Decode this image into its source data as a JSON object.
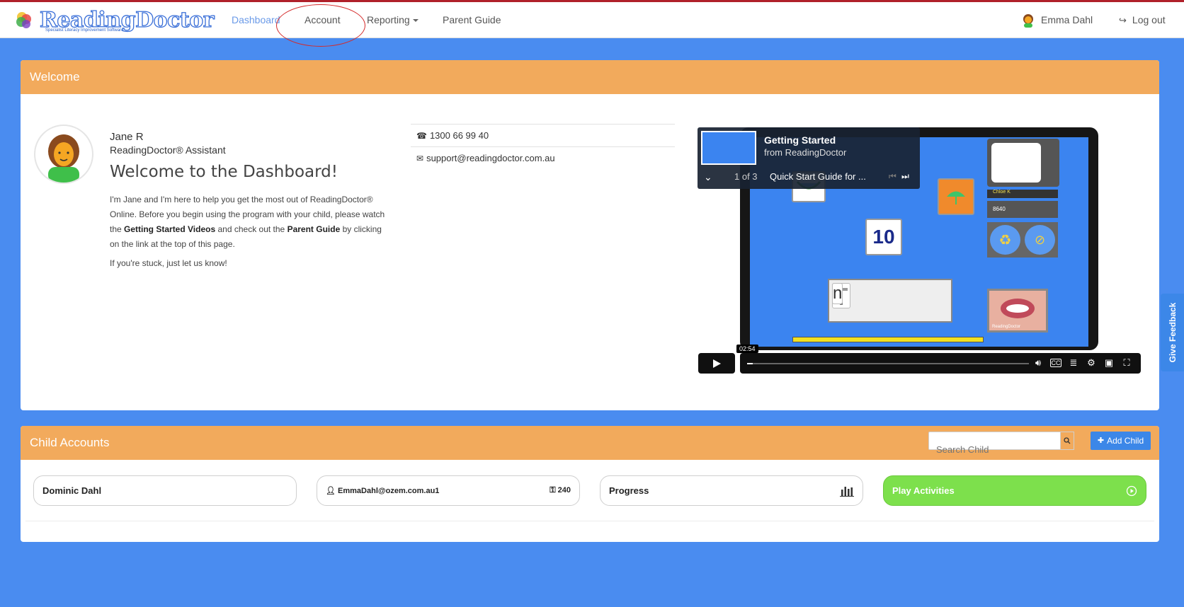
{
  "nav": {
    "logo_text": "ReadingDoctor",
    "logo_tagline": "Specialist Literacy Improvement Software",
    "items": [
      {
        "label": "Dashboard"
      },
      {
        "label": "Account"
      },
      {
        "label": "Reporting"
      },
      {
        "label": "Parent Guide"
      }
    ],
    "user_name": "Emma Dahl",
    "logout_label": "Log out"
  },
  "welcome": {
    "heading": "Welcome",
    "assistant_name": "Jane R",
    "assistant_role": "ReadingDoctor® Assistant",
    "title": "Welcome to the Dashboard!",
    "para_1": "I'm Jane and I'm here to help you get the most out of ReadingDoctor® Online. Before you begin using the program with your child, please watch the ",
    "para_bold_1": "Getting Started Videos",
    "para_2": " and check out the ",
    "para_bold_2": "Parent Guide",
    "para_3": " by clicking on the link at the top of this page.",
    "stuck_text": "If you're stuck, just let us know!",
    "phone": "1300 66 99 40",
    "email": "support@readingdoctor.com.au"
  },
  "video": {
    "title": "Getting Started",
    "from": "from ReadingDoctor",
    "playlist_count": "1 of 3",
    "next_title": "Quick Start Guide for ...",
    "time": "02:54",
    "progress": 0.02,
    "screen_labels": {
      "number": "10",
      "letter_1": "i",
      "letter_2": "n",
      "name_tag": "Chloe K",
      "score": "8640",
      "mouth_label": "ReadingDoctor"
    }
  },
  "children": {
    "heading": "Child Accounts",
    "search_placeholder": "Search Child",
    "add_child_label": "Add Child",
    "child_name": "Dominic Dahl",
    "login": "EmmaDahl@ozem.com.au1",
    "password": "240",
    "progress_label": "Progress",
    "play_label": "Play Activities"
  },
  "feedback_label": "Give Feedback",
  "colors": {
    "page_bg": "#4a8cf0",
    "panel_header": "#f2aa5c",
    "primary_button": "#3c87e8",
    "play_green": "#7de04c",
    "annotation_red": "#d42a2a"
  }
}
